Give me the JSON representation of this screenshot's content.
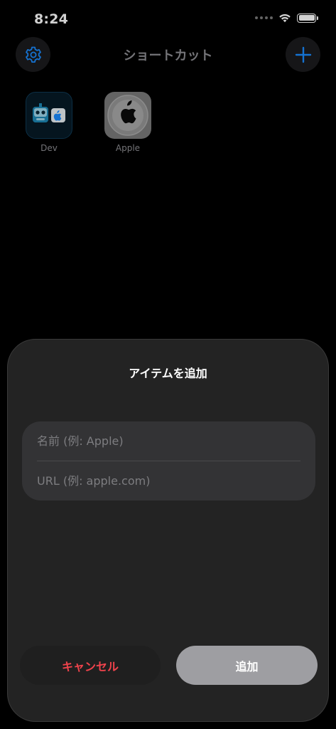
{
  "status_bar": {
    "time": "8:24"
  },
  "nav": {
    "title": "ショートカット",
    "settings_icon": "gear-icon",
    "add_icon": "plus-icon",
    "accent_color": "#1a8cff"
  },
  "shortcuts": [
    {
      "label": "Dev",
      "icon": "dev-icon"
    },
    {
      "label": "Apple",
      "icon": "apple-logo-icon"
    }
  ],
  "sheet": {
    "title": "アイテムを追加",
    "name_field": {
      "value": "",
      "placeholder": "名前 (例: Apple)"
    },
    "url_field": {
      "value": "",
      "placeholder": "URL (例: apple.com)"
    },
    "cancel_label": "キャンセル",
    "submit_label": "追加",
    "cancel_color": "#f0434c"
  }
}
